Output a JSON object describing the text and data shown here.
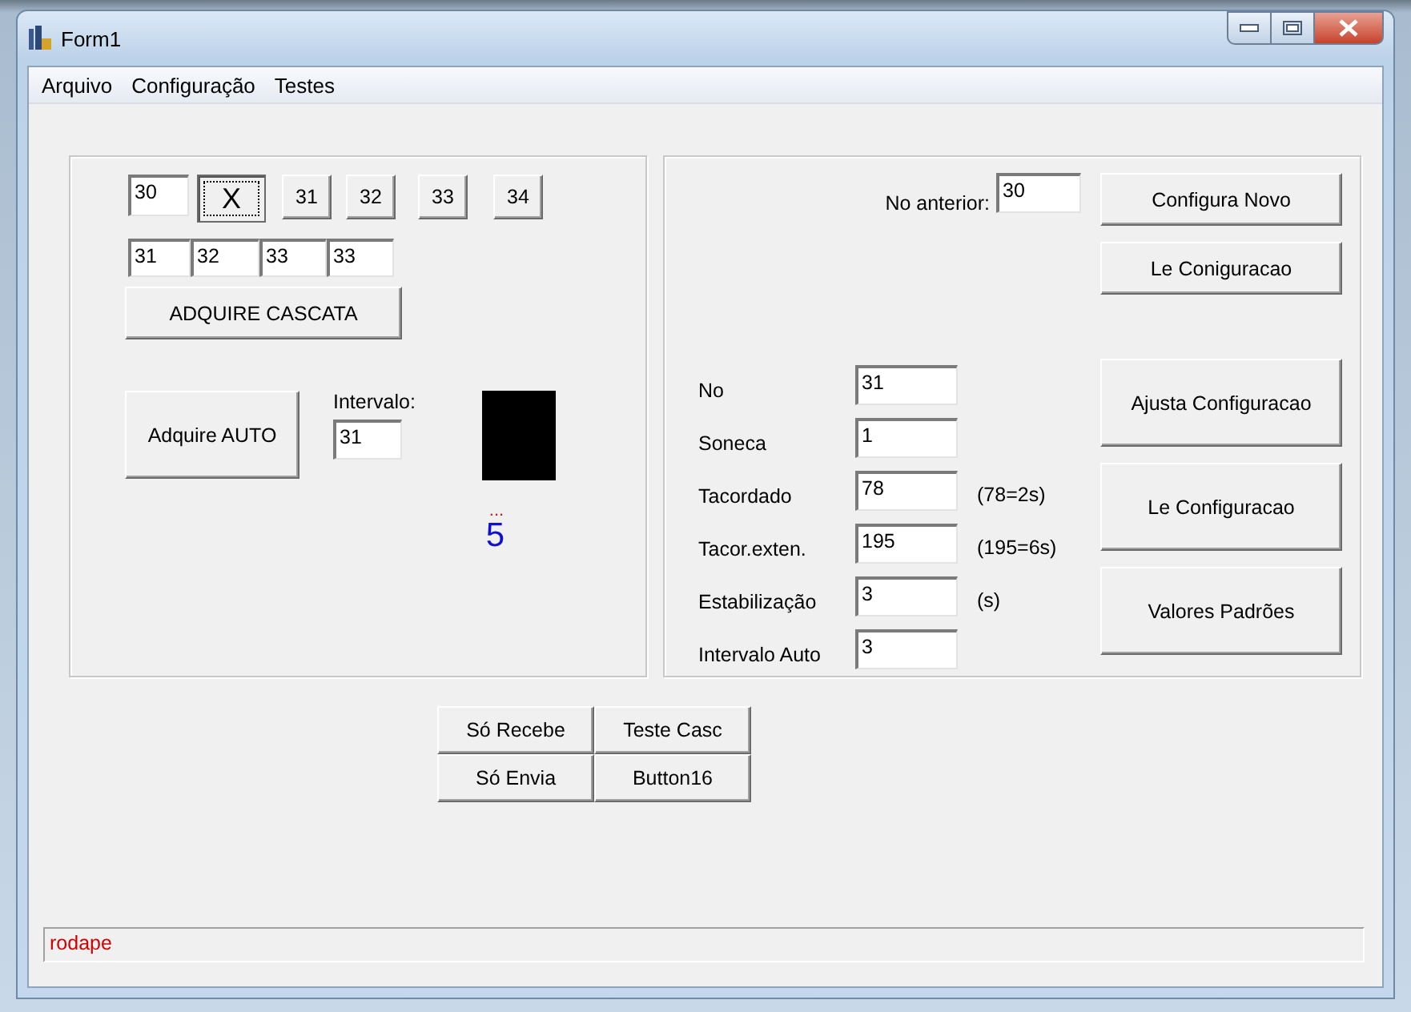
{
  "window": {
    "title": "Form1"
  },
  "menu": [
    {
      "label": "Arquivo"
    },
    {
      "label": "Configuração"
    },
    {
      "label": "Testes"
    }
  ],
  "left_panel": {
    "node_field": "30",
    "clear_button": {
      "label": "X",
      "focused": true
    },
    "node_buttons": [
      "31",
      "32",
      "33",
      "34"
    ],
    "cascade_fields": [
      "31",
      "32",
      "33",
      "33"
    ],
    "cascade_button": "ADQUIRE CASCATA",
    "auto_button": "Adquire AUTO",
    "interval_label": "Intervalo:",
    "interval_field": "31",
    "indicator_dots": "...",
    "counter": "5"
  },
  "right_panel": {
    "previous_label": "No anterior:",
    "previous_field": "30",
    "top_buttons": [
      "Configura Novo",
      "Le Coniguracao"
    ],
    "rows": [
      {
        "label": "No",
        "value": "31"
      },
      {
        "label": "Soneca",
        "value": "1"
      },
      {
        "label": "Tacordado",
        "value": "78",
        "hint": "(78=2s)"
      },
      {
        "label": "Tacor.exten.",
        "value": "195",
        "hint": "(195=6s)"
      },
      {
        "label": "Estabilização",
        "value": "3",
        "hint": "(s)"
      },
      {
        "label": "Intervalo Auto",
        "value": "3"
      }
    ],
    "side_buttons": [
      "Ajusta Configuracao",
      "Le Configuracao",
      "Valores Padrões"
    ]
  },
  "test_buttons": [
    "Só Recebe",
    "Teste Casc",
    "Só Envia",
    "Button16"
  ],
  "status_bar": {
    "text": "rodape"
  }
}
